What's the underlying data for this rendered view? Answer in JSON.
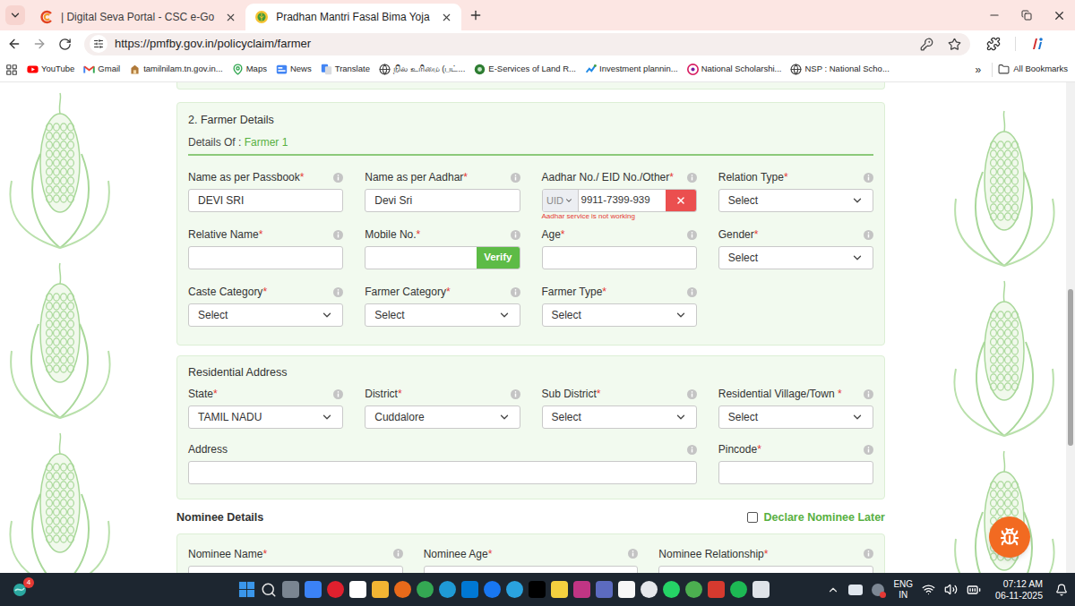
{
  "browser": {
    "tabs": [
      {
        "title": "| Digital Seva Portal - CSC e-Go",
        "selected": false
      },
      {
        "title": "Pradhan Mantri Fasal Bima Yoja",
        "selected": true
      }
    ],
    "url": "https://pmfby.gov.in/policyclaim/farmer",
    "bookmarks": [
      {
        "label": "YouTube"
      },
      {
        "label": "Gmail"
      },
      {
        "label": "tamilnilam.tn.gov.in..."
      },
      {
        "label": "Maps"
      },
      {
        "label": "News"
      },
      {
        "label": "Translate"
      },
      {
        "label": "நில உரிமை (பட்..."
      },
      {
        "label": "E-Services of Land R..."
      },
      {
        "label": "Investment plannin..."
      },
      {
        "label": "National Scholarshi..."
      },
      {
        "label": "NSP : National Scho..."
      }
    ],
    "more": "»",
    "all_bookmarks": "All Bookmarks"
  },
  "farmer_details": {
    "title": "2. Farmer Details",
    "details_of": "Details Of :",
    "farmer": "Farmer 1",
    "fields": [
      {
        "label": "Name as per Passbook",
        "mark": "*",
        "kind": "input",
        "value": "DEVI SRI"
      },
      {
        "label": "Name as per Aadhar",
        "mark": "*",
        "kind": "input",
        "value": "Devi Sri"
      },
      {
        "label": "Aadhar No./ EID No./Other",
        "mark": "*",
        "kind": "id",
        "prefix": "UID",
        "value": "9911-7399-939",
        "error": "Aadhar service is not working"
      },
      {
        "label": "Relation Type",
        "mark": "*",
        "kind": "select",
        "value": "Select"
      },
      {
        "label": "Relative Name",
        "mark": "*",
        "kind": "input",
        "value": ""
      },
      {
        "label": "Mobile No.",
        "mark": "*",
        "kind": "verify",
        "value": "",
        "button": "Verify"
      },
      {
        "label": "Age",
        "mark": "*",
        "kind": "input",
        "value": ""
      },
      {
        "label": "Gender",
        "mark": "*",
        "kind": "select",
        "value": "Select"
      },
      {
        "label": "Caste Category",
        "mark": "*",
        "kind": "select",
        "value": "Select"
      },
      {
        "label": "Farmer Category",
        "mark": "*",
        "kind": "select",
        "value": "Select"
      },
      {
        "label": "Farmer Type",
        "mark": "*",
        "kind": "select",
        "value": "Select"
      }
    ]
  },
  "residential_address": {
    "title": "Residential Address",
    "fields": [
      {
        "label": "State",
        "mark": "*",
        "kind": "select",
        "value": "TAMIL NADU"
      },
      {
        "label": "District",
        "mark": "*",
        "kind": "select",
        "value": "Cuddalore"
      },
      {
        "label": "Sub District",
        "mark": "*",
        "kind": "select",
        "value": "Select"
      },
      {
        "label": "Residential Village/Town",
        "mark": " *",
        "kind": "select",
        "value": "Select"
      },
      {
        "label": "Address",
        "mark": "",
        "kind": "wide",
        "value": ""
      },
      {
        "label": "Pincode",
        "mark": "*",
        "kind": "input",
        "value": ""
      }
    ]
  },
  "nominee": {
    "title": "Nominee Details",
    "declare_later": {
      "label": "Declare Nominee Later",
      "checked": false
    },
    "fields": [
      {
        "label": "Nominee Name",
        "mark": "*",
        "kind": "input",
        "value": ""
      },
      {
        "label": "Nominee Age",
        "mark": "*",
        "kind": "input",
        "value": ""
      },
      {
        "label": "Nominee Relationship",
        "mark": "*",
        "kind": "input",
        "value": ""
      }
    ]
  },
  "scrollbar": {
    "level": 0.62
  },
  "taskbar": {
    "badge": "4",
    "language": [
      "ENG",
      "IN"
    ],
    "time": "07:12 AM",
    "date": "06-11-2025"
  }
}
